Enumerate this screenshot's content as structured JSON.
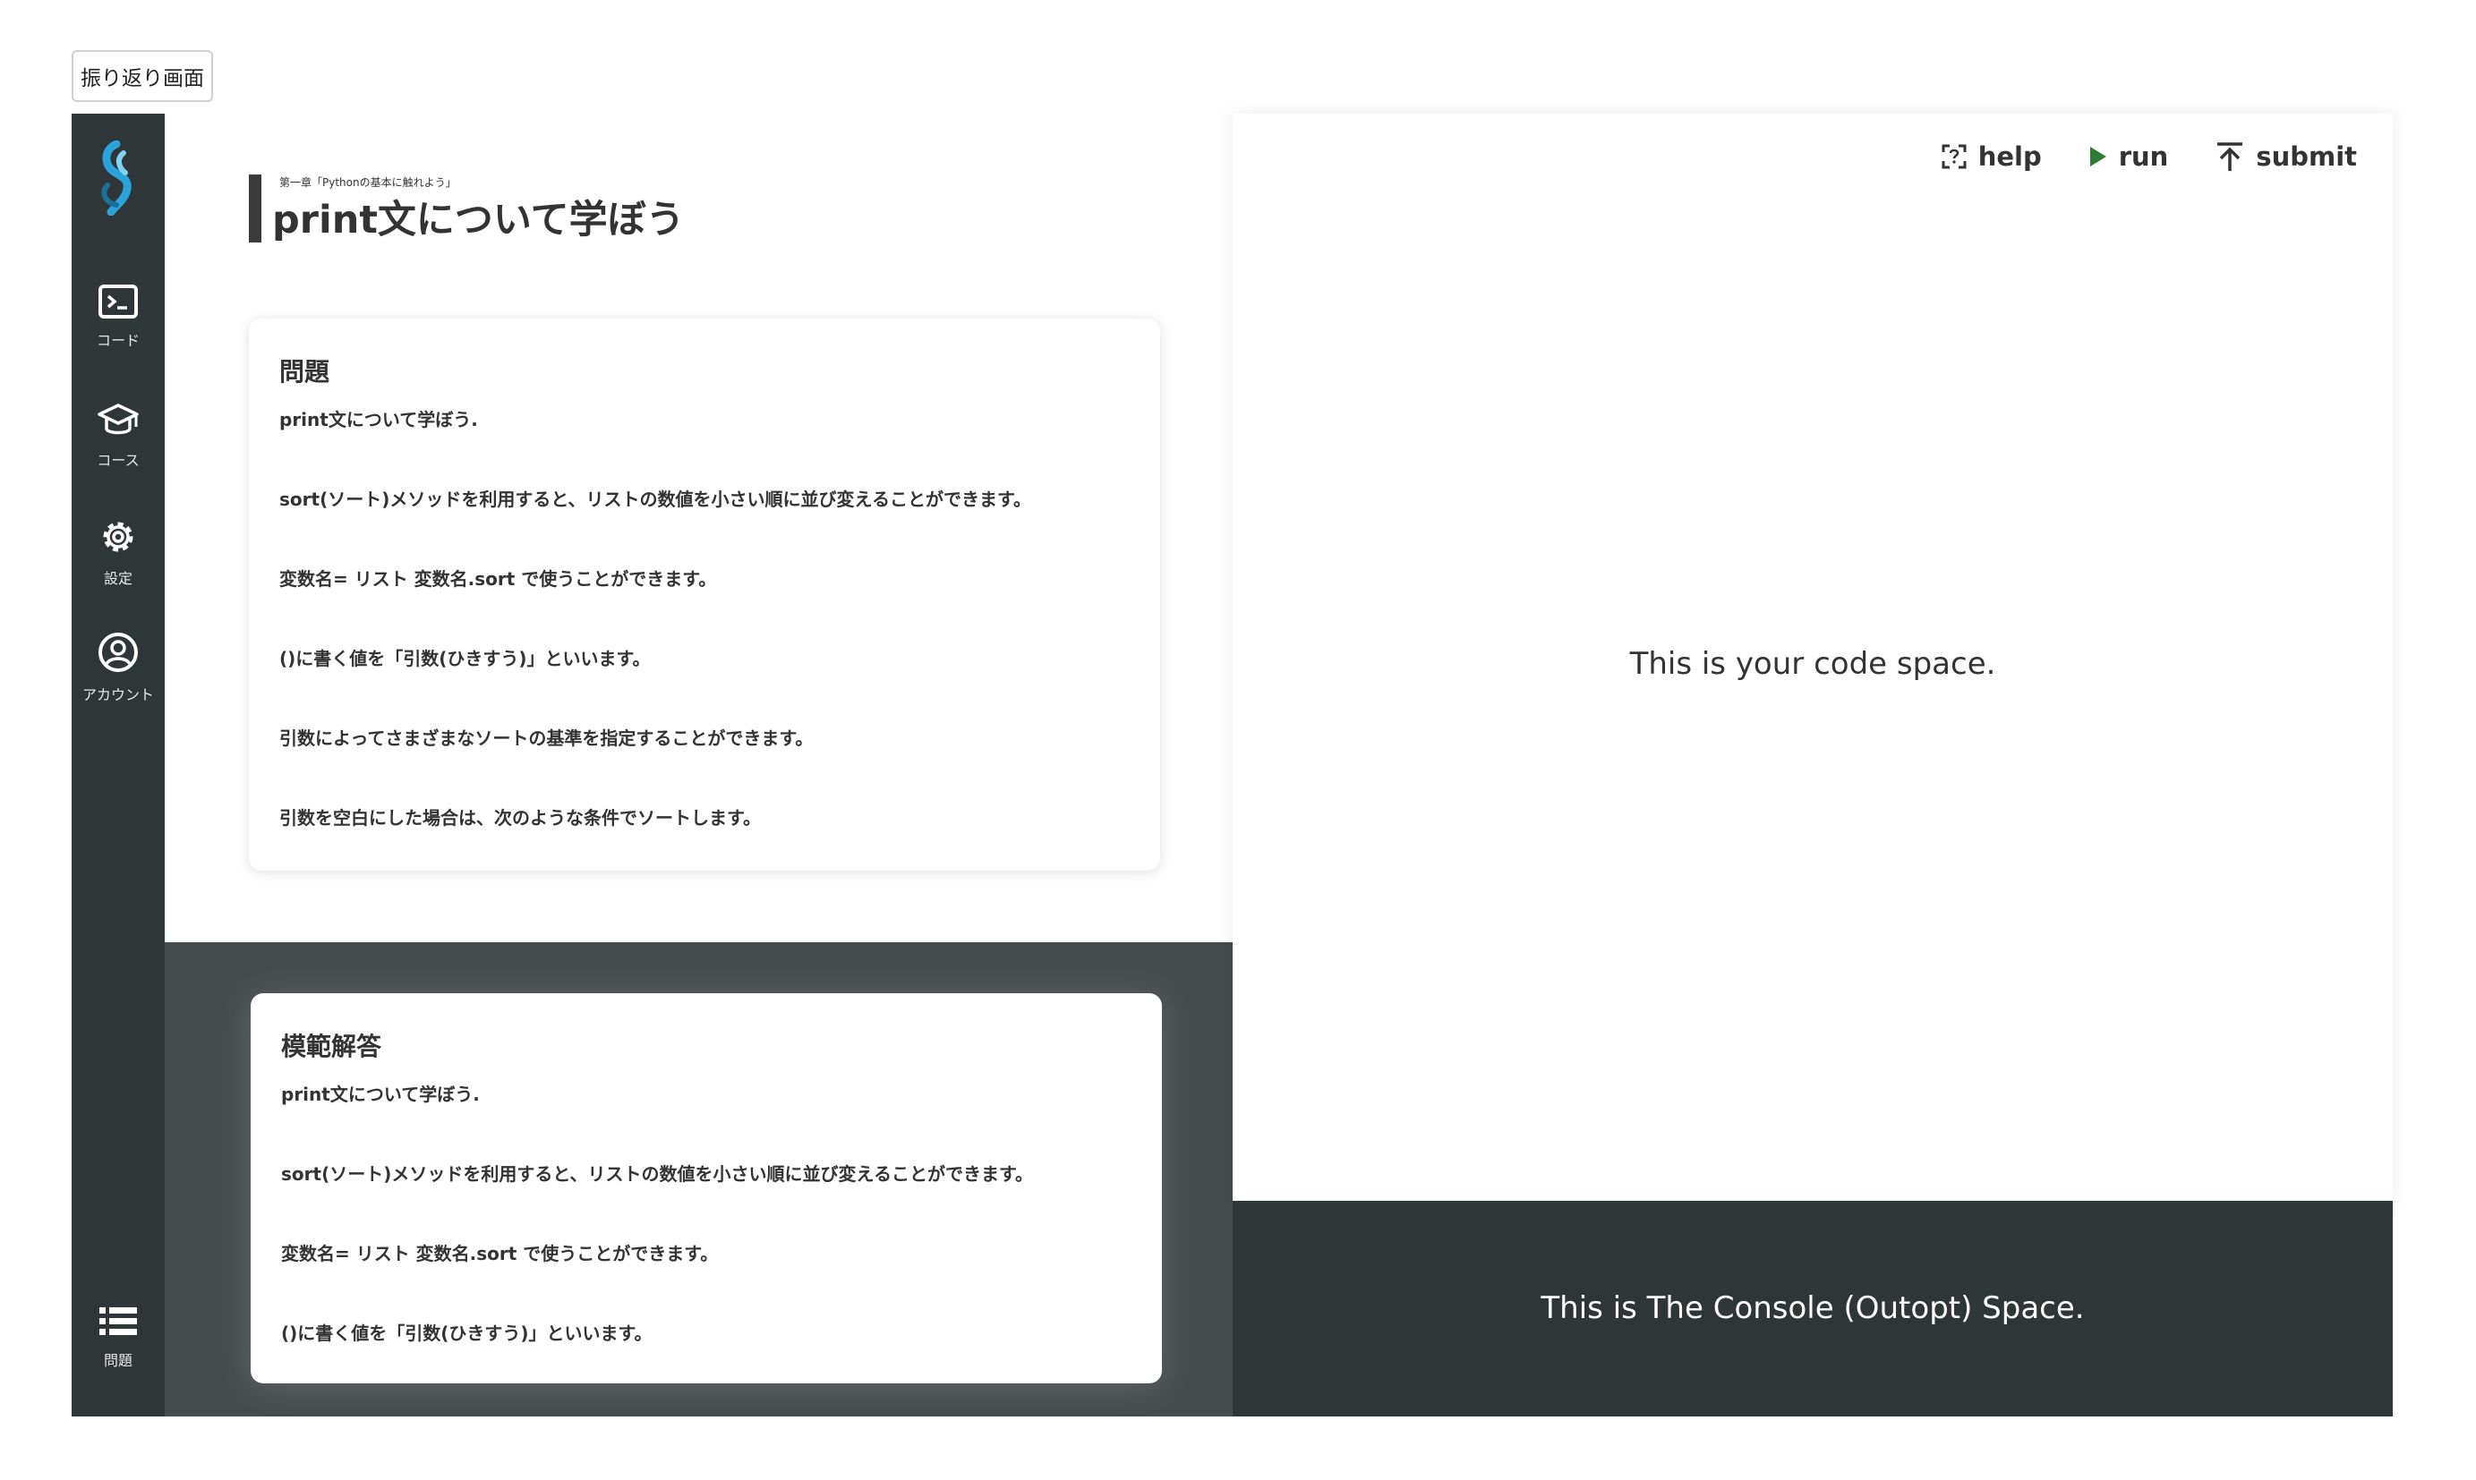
{
  "review_button": "振り返り画面",
  "sidebar": {
    "items": [
      {
        "label": "コード",
        "icon": "terminal-icon"
      },
      {
        "label": "コース",
        "icon": "graduation-cap-icon"
      },
      {
        "label": "設定",
        "icon": "gear-icon"
      },
      {
        "label": "アカウント",
        "icon": "account-circle-icon"
      }
    ],
    "bottom_item": {
      "label": "問題",
      "icon": "list-icon"
    }
  },
  "header": {
    "chapter": "第一章「Pythonの基本に触れよう」",
    "title": "print文について学ぼう"
  },
  "problem": {
    "heading": "問題",
    "lines": [
      "print文について学ぼう.",
      "sort(ソート)メソッドを利用すると、リストの数値を小さい順に並び変えることができます。",
      "変数名= リスト 変数名.sort で使うことができます。",
      "()に書く値を「引数(ひきすう)」といいます。",
      "引数によってさまざまなソートの基準を指定することができます。",
      "引数を空白にした場合は、次のような条件でソートします。"
    ]
  },
  "answer": {
    "heading": "模範解答",
    "lines": [
      "print文について学ぼう.",
      "sort(ソート)メソッドを利用すると、リストの数値を小さい順に並び変えることができます。",
      "変数名= リスト 変数名.sort で使うことができます。",
      "()に書く値を「引数(ひきすう)」といいます。"
    ]
  },
  "toolbar": {
    "help": "help",
    "run": "run",
    "submit": "submit"
  },
  "code_space": "This is your code space.",
  "console_space": "This is The Console (Outopt) Space.",
  "colors": {
    "sidebar": "#2f3638",
    "answer_bg": "#464c4d",
    "run_accent": "#2e7d32",
    "logo_accent": "#29a3d9"
  }
}
